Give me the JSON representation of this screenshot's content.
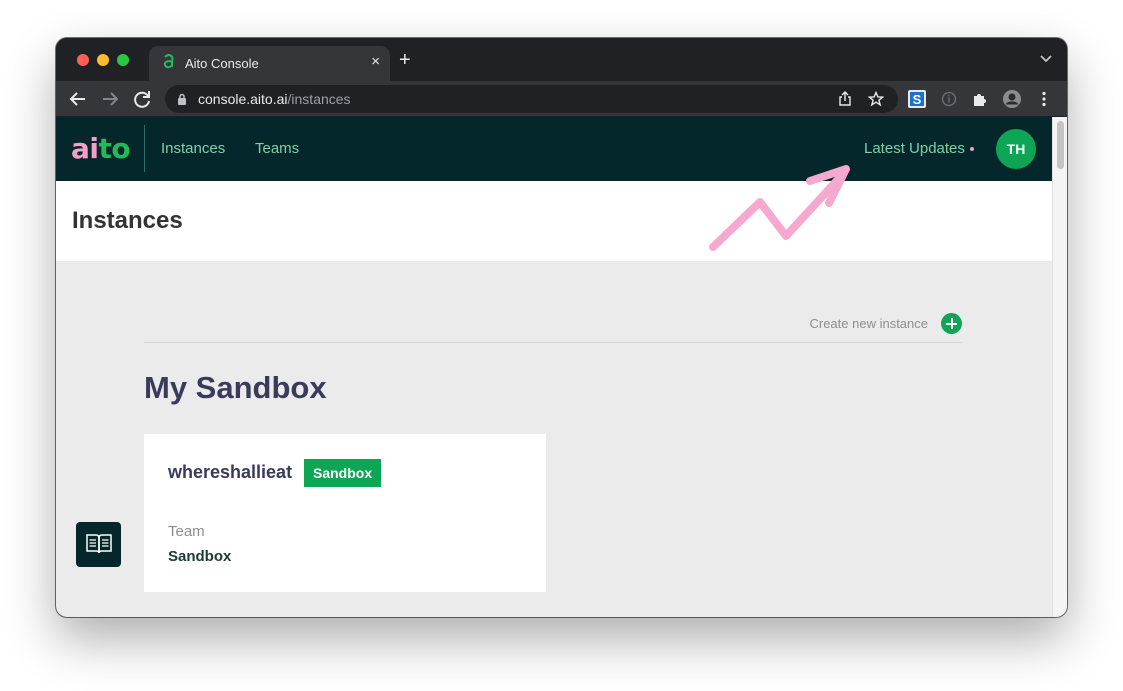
{
  "browser": {
    "tab_title": "Aito Console",
    "close_glyph": "×",
    "new_tab_glyph": "+",
    "url_domain": "console.aito.ai",
    "url_path": "/instances"
  },
  "header": {
    "logo_part1": "ai",
    "logo_part2": "to",
    "nav": {
      "instances": "Instances",
      "teams": "Teams"
    },
    "latest_updates": "Latest Updates",
    "avatar_initials": "TH"
  },
  "page": {
    "title": "Instances",
    "create_new_label": "Create new instance",
    "section_title": "My Sandbox"
  },
  "instance_card": {
    "name": "whereshallieat",
    "badge": "Sandbox",
    "team_label": "Team",
    "team_name": "Sandbox"
  },
  "colors": {
    "header_bg": "#04272b",
    "brand_green": "#0ea554",
    "logo_pink": "#f3a0c8",
    "nav_link": "#7ed1a5",
    "annotation_pink": "#f6a9cf"
  },
  "icons": [
    "back-arrow-icon",
    "forward-arrow-icon",
    "reload-icon",
    "lock-icon",
    "share-icon",
    "star-icon",
    "extension-s-icon",
    "info-icon",
    "puzzle-icon",
    "profile-icon",
    "kebab-menu-icon",
    "book-icon",
    "plus-icon"
  ]
}
